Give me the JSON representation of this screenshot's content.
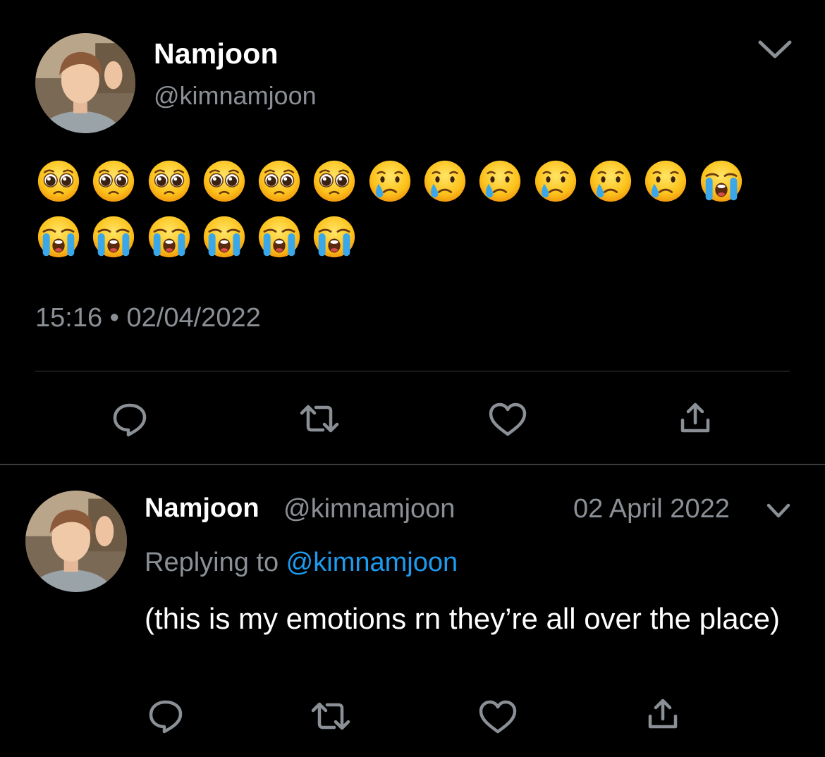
{
  "main_tweet": {
    "display_name": "Namjoon",
    "handle": "@kimnamjoon",
    "emoji_row1": [
      "pleading-face",
      "pleading-face",
      "pleading-face",
      "pleading-face",
      "pleading-face",
      "pleading-face",
      "crying-face",
      "crying-face",
      "crying-face",
      "crying-face",
      "crying-face",
      "crying-face",
      "loudly-crying-face"
    ],
    "emoji_row2": [
      "loudly-crying-face",
      "loudly-crying-face",
      "loudly-crying-face",
      "loudly-crying-face",
      "loudly-crying-face",
      "loudly-crying-face"
    ],
    "time": "15:16",
    "separator": "•",
    "date": "02/04/2022",
    "actions": [
      "reply-icon",
      "retweet-icon",
      "like-icon",
      "share-icon"
    ]
  },
  "reply_tweet": {
    "display_name": "Namjoon",
    "handle": "@kimnamjoon",
    "date": "02 April 2022",
    "replying_prefix": "Replying to ",
    "replying_handle": "@kimnamjoon",
    "text": "(this is my emotions rn they’re all over the place)",
    "actions": [
      "reply-icon",
      "retweet-icon",
      "like-icon",
      "share-icon"
    ]
  },
  "colors": {
    "background": "#000000",
    "primary_text": "#ffffff",
    "secondary_text": "#8b9096",
    "link": "#1d9bf0",
    "icon": "#8b9096",
    "divider": "#3a3d40"
  }
}
